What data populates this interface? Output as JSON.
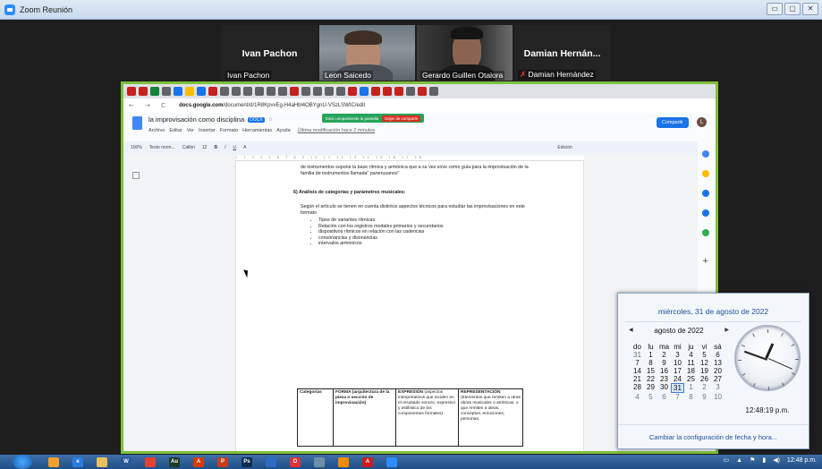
{
  "window": {
    "title": "Zoom Reunión",
    "controls": [
      "▭",
      "▢",
      "✕"
    ]
  },
  "gallery": [
    {
      "display_name": "Ivan Pachon",
      "label": "Ivan Pachon",
      "video": false,
      "muted": false
    },
    {
      "display_name": "",
      "label": "Leon Saicedo",
      "video": true,
      "muted": false
    },
    {
      "display_name": "",
      "label": "Gerardo Guillen Otalora",
      "video": true,
      "muted": false,
      "active_speaker": true
    },
    {
      "display_name": "Damian Hernán...",
      "label": "Damian Hernández",
      "video": false,
      "muted": true
    }
  ],
  "browser": {
    "url_prefix": "docs.google.com",
    "url_rest": "/document/d/1R8KpvvEg-H4aHbl4OBYgnU-VSzLSWIC/edit",
    "nav": "← → C"
  },
  "doc": {
    "title": "la improvisación como disciplina",
    "badge": "DOCX",
    "menu": [
      "Archivo",
      "Editar",
      "Ver",
      "Insertar",
      "Formato",
      "Herramientas",
      "Ayuda"
    ],
    "last_edit": "Última modificación hace 2 minutos",
    "share_banner": "Está compartiendo la pantalla",
    "stop_share": "Dejar de compartir",
    "share_button": "Compartir",
    "user_initial": "L",
    "toolbar": [
      "100%",
      "Texto norm...",
      "Calibri",
      "12",
      "B",
      "I",
      "U",
      "A",
      "Edición"
    ],
    "ruler": "1 2 3 4 5 6 7 8 9 10 11 12 13 14 15 16 17 18",
    "body": {
      "para1": "de instrumentos supone la base rítmica y armónica que a su vez sirve como guía para la improvisación de la familia de instrumentos llamada\" panerusanos\"",
      "heading": "6)   Análisis de categorías y parámetros musicales:",
      "para2": "Según el artículo se tienen en cuenta distintos aspectos técnicos para estudiar las improvisaciones en este formato",
      "bullets": [
        "Tipos de variantes rítmicas",
        "Relación con los registros modales primarios y secundarios",
        "dispositivos rítmicos en relación con las cadencias",
        "consonancias y disonancias",
        "intervalos armónicos"
      ],
      "table": {
        "c1": "Categorías",
        "c2": "FORMA (arquitectura de la pieza o sección de improvisación)",
        "c3_title": "EXPRESIÓN",
        "c3_body": "(aspectos interpretativos que inciden en el resultado sonoro, expresivo y estilístico de los componentes formales)",
        "c4_title": "REPRESENTACIÓN",
        "c4_body": "(Elementos que remiten a otras obras musicales o artísticas, o que remiten a ideas, conceptos, emociones, personas,"
      }
    }
  },
  "calendar": {
    "long_date": "miércoles, 31 de agosto de 2022",
    "month": "agosto de 2022",
    "weekdays": [
      "do",
      "lu",
      "ma",
      "mi",
      "ju",
      "vi",
      "sá"
    ],
    "days": [
      [
        "31",
        "o"
      ],
      [
        "1",
        ""
      ],
      [
        "2",
        ""
      ],
      [
        "3",
        ""
      ],
      [
        "4",
        ""
      ],
      [
        "5",
        ""
      ],
      [
        "6",
        ""
      ],
      [
        "7",
        ""
      ],
      [
        "8",
        ""
      ],
      [
        "9",
        ""
      ],
      [
        "10",
        ""
      ],
      [
        "11",
        ""
      ],
      [
        "12",
        ""
      ],
      [
        "13",
        ""
      ],
      [
        "14",
        ""
      ],
      [
        "15",
        ""
      ],
      [
        "16",
        ""
      ],
      [
        "17",
        ""
      ],
      [
        "18",
        ""
      ],
      [
        "19",
        ""
      ],
      [
        "20",
        ""
      ],
      [
        "21",
        ""
      ],
      [
        "22",
        ""
      ],
      [
        "23",
        ""
      ],
      [
        "24",
        ""
      ],
      [
        "25",
        ""
      ],
      [
        "26",
        ""
      ],
      [
        "27",
        ""
      ],
      [
        "28",
        ""
      ],
      [
        "29",
        ""
      ],
      [
        "30",
        ""
      ],
      [
        "31",
        "sel"
      ],
      [
        "1",
        "o"
      ],
      [
        "2",
        "o"
      ],
      [
        "3",
        "o"
      ],
      [
        "4",
        "o"
      ],
      [
        "5",
        "o"
      ],
      [
        "6",
        "o"
      ],
      [
        "7",
        "o"
      ],
      [
        "8",
        "o"
      ],
      [
        "9",
        "o"
      ],
      [
        "10",
        "o"
      ]
    ],
    "time": "12:48:19 p.m.",
    "clock": {
      "hour": 12,
      "minute": 48,
      "second": 19
    },
    "footer": "Cambiar la configuración de fecha y hora..."
  },
  "taskbar": {
    "apps": [
      {
        "icon": "file-explorer-icon",
        "color": "#f0a030",
        "label": ""
      },
      {
        "icon": "ie-icon",
        "color": "#2b7be0",
        "label": "e"
      },
      {
        "icon": "folder-icon",
        "color": "#e8c060",
        "label": ""
      },
      {
        "icon": "word-icon",
        "color": "#2b579a",
        "label": "W"
      },
      {
        "icon": "chrome-icon",
        "color": "#e34133",
        "label": ""
      },
      {
        "icon": "audition-icon",
        "color": "#1f3b2a",
        "label": "Au"
      },
      {
        "icon": "acrobat-icon",
        "color": "#d83b01",
        "label": "A"
      },
      {
        "icon": "powerpoint-icon",
        "color": "#c43e1c",
        "label": "P"
      },
      {
        "icon": "photoshop-icon",
        "color": "#0b2d53",
        "label": "Ps"
      },
      {
        "icon": "mail-icon",
        "color": "#2d6bc4",
        "label": ""
      },
      {
        "icon": "opera-icon",
        "color": "#e0303a",
        "label": "O"
      },
      {
        "icon": "browser-icon",
        "color": "#6f8fa8",
        "label": ""
      },
      {
        "icon": "vlc-icon",
        "color": "#f08a00",
        "label": ""
      },
      {
        "icon": "acrobat-reader-icon",
        "color": "#c7201f",
        "label": "A"
      },
      {
        "icon": "zoom-icon",
        "color": "#2d8cff",
        "label": ""
      }
    ],
    "clock": "12:48 p.m."
  }
}
